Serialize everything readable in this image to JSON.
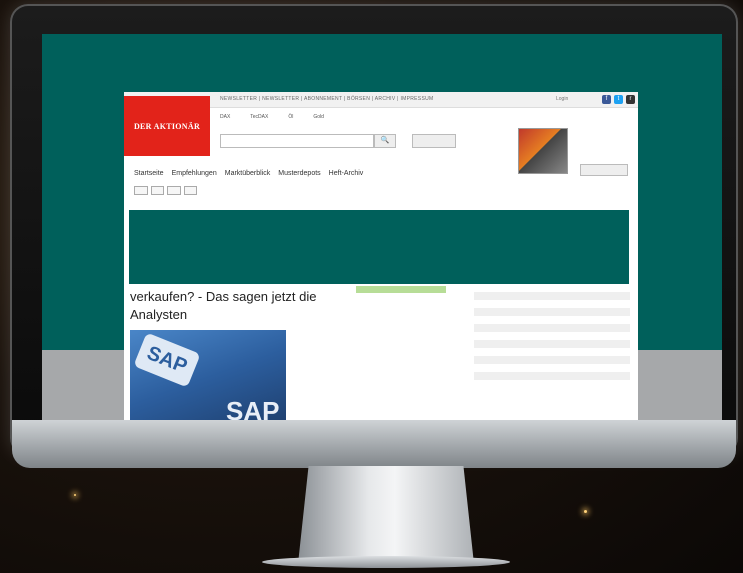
{
  "page": {
    "topnav_links": "NEWSLETTER | NEWSLETTER | ABONNEMENT | BÖRSEN | ARCHIV | IMPRESSUM",
    "login": "Login",
    "logo_text": "DER AKTIONÄR",
    "ticker": [
      {
        "name": "DAX",
        "value": "",
        "change": "",
        "trend": "up"
      },
      {
        "name": "TecDAX",
        "value": "",
        "change": "",
        "trend": "dn"
      },
      {
        "name": "Öl",
        "value": "",
        "change": "",
        "trend": "up"
      },
      {
        "name": "Gold",
        "value": "",
        "change": "",
        "trend": "dn"
      }
    ],
    "search_placeholder": "",
    "search_button": "🔍",
    "select_label": "",
    "magazine_text": "",
    "magazine_button": "",
    "main_nav": [
      "Startseite",
      "Empfehlungen",
      "Marktüberblick",
      "Musterdepots",
      "Heft-Archiv"
    ],
    "sub_tabs": [
      "",
      "",
      "",
      ""
    ],
    "headline": "verkaufen? - Das sagen jetzt die Analysten",
    "article_text": "",
    "sap_image_text_1": "SAP",
    "sap_image_text_2": "SAP",
    "table_rows": [
      {
        "name": "",
        "price": "",
        "change": "",
        "trend": "up"
      },
      {
        "name": "",
        "price": "",
        "change": "",
        "trend": "up"
      },
      {
        "name": "",
        "price": "",
        "change": "",
        "trend": "up"
      },
      {
        "name": "",
        "price": "",
        "change": "",
        "trend": "dn"
      },
      {
        "name": "",
        "price": "",
        "change": "",
        "trend": "up"
      },
      {
        "name": "",
        "price": "",
        "change": "",
        "trend": "up"
      },
      {
        "name": "",
        "price": "",
        "change": "",
        "trend": "up"
      },
      {
        "name": "",
        "price": "",
        "change": "",
        "trend": "dn"
      },
      {
        "name": "",
        "price": "",
        "change": "",
        "trend": "up"
      },
      {
        "name": "",
        "price": "",
        "change": "",
        "trend": "up"
      },
      {
        "name": "",
        "price": "",
        "change": "",
        "trend": "dn"
      },
      {
        "name": "",
        "price": "",
        "change": "",
        "trend": "up"
      }
    ]
  },
  "monitor": {
    "logo_icon": "apple-logo-icon"
  },
  "colors": {
    "accent": "#e2231a",
    "teal": "#00605b",
    "up": "#2e9a3b",
    "down": "#dd2222"
  }
}
